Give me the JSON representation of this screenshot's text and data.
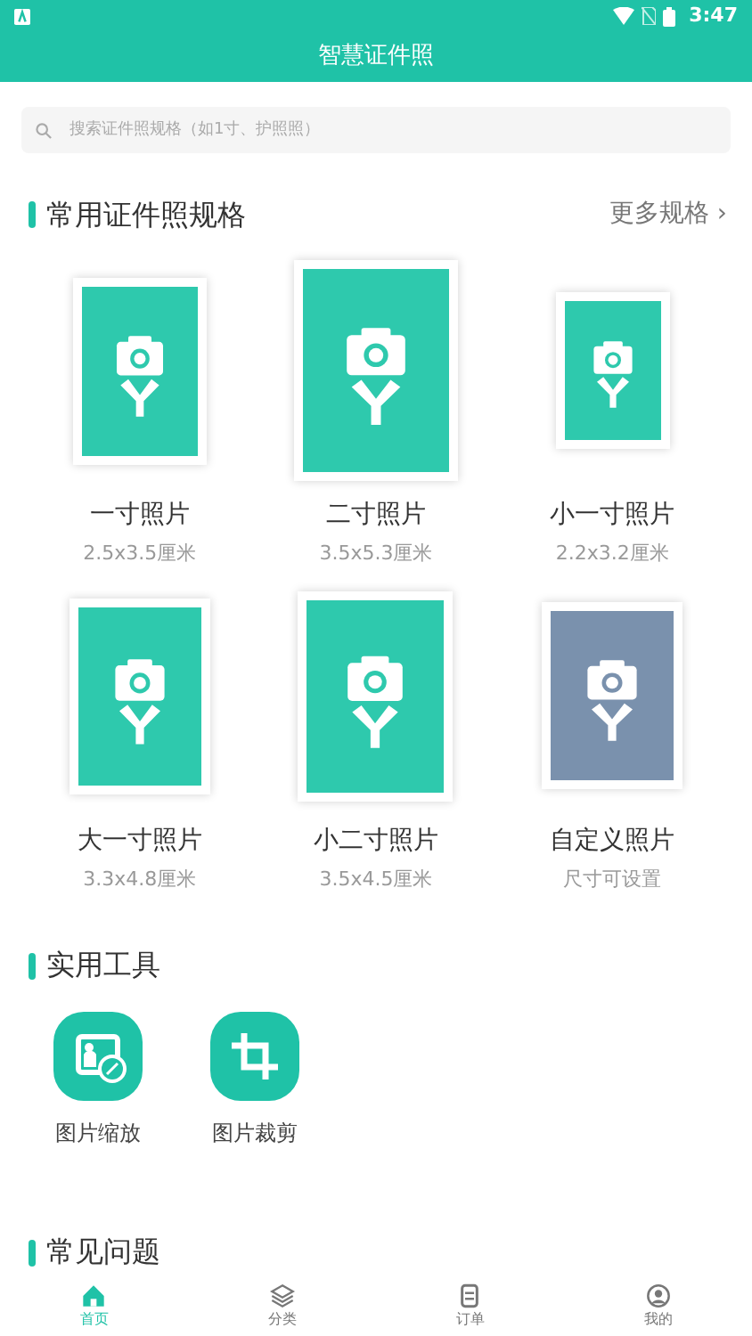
{
  "status_bar": {
    "time": "3:47"
  },
  "header": {
    "title": "智慧证件照"
  },
  "search": {
    "placeholder": "搜索证件照规格（如1寸、护照照）"
  },
  "common_specs": {
    "title": "常用证件照规格",
    "more_link": "更多规格 ›",
    "items": [
      {
        "name": "一寸照片",
        "size": "2.5x3.5厘米",
        "color": "#2ec9ad"
      },
      {
        "name": "二寸照片",
        "size": "3.5x5.3厘米",
        "color": "#2ec9ad"
      },
      {
        "name": "小一寸照片",
        "size": "2.2x3.2厘米",
        "color": "#2ec9ad"
      },
      {
        "name": "大一寸照片",
        "size": "3.3x4.8厘米",
        "color": "#2ec9ad"
      },
      {
        "name": "小二寸照片",
        "size": "3.5x4.5厘米",
        "color": "#2ec9ad"
      },
      {
        "name": "自定义照片",
        "size": "尺寸可设置",
        "color": "#7a91ad"
      }
    ]
  },
  "tools": {
    "title": "实用工具",
    "items": [
      {
        "label": "图片缩放",
        "kind": "resize"
      },
      {
        "label": "图片裁剪",
        "kind": "crop"
      }
    ]
  },
  "faq": {
    "title": "常见问题"
  },
  "tab_bar": [
    {
      "label": "首页",
      "kind": "home",
      "selected": true
    },
    {
      "label": "分类",
      "kind": "layers",
      "selected": false
    },
    {
      "label": "订单",
      "kind": "order",
      "selected": false
    },
    {
      "label": "我的",
      "kind": "user",
      "selected": false
    }
  ]
}
